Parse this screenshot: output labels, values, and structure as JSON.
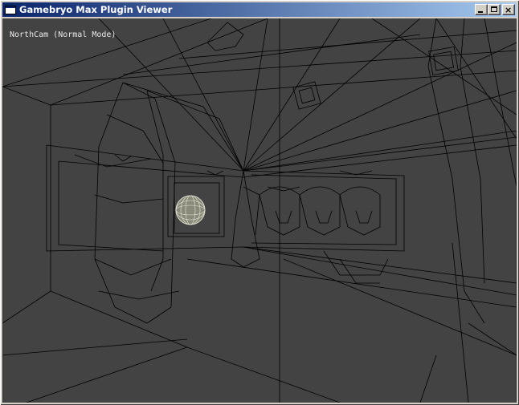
{
  "window": {
    "title": "Gamebryo Max Plugin Viewer",
    "controls": {
      "minimize": "minimize",
      "maximize": "maximize",
      "close": "close"
    }
  },
  "viewport": {
    "camera_label": "NorthCam (Normal Mode)",
    "background_color": "#434343",
    "wire_color": "#000000"
  },
  "colors": {
    "titlebar_start": "#0a246a",
    "titlebar_end": "#a6caf0",
    "chrome": "#d4d0c8"
  }
}
